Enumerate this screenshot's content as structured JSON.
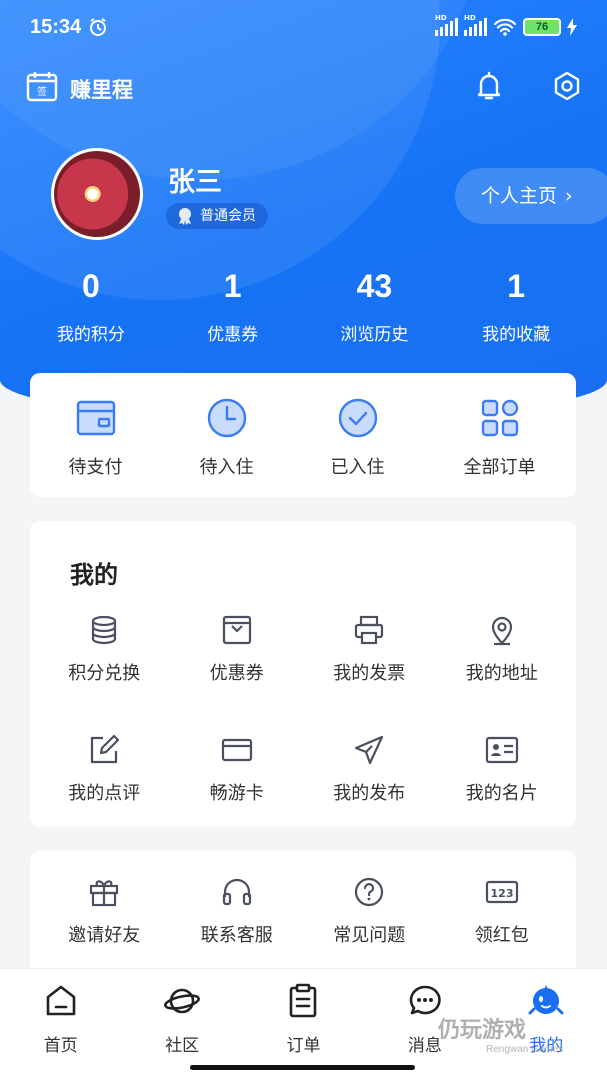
{
  "status_bar": {
    "time": "15:34",
    "battery": "76",
    "signal_label": "HD"
  },
  "header": {
    "brand_name": "赚里程"
  },
  "profile": {
    "name": "张三",
    "member_level": "普通会员",
    "homepage_label": "个人主页",
    "homepage_chevron": "›"
  },
  "stats": [
    {
      "value": "0",
      "label": "我的积分"
    },
    {
      "value": "1",
      "label": "优惠券"
    },
    {
      "value": "43",
      "label": "浏览历史"
    },
    {
      "value": "1",
      "label": "我的收藏"
    }
  ],
  "orders": [
    {
      "label": "待支付",
      "icon": "wallet-icon"
    },
    {
      "label": "待入住",
      "icon": "clock-icon"
    },
    {
      "label": "已入住",
      "icon": "check-circle-icon"
    },
    {
      "label": "全部订单",
      "icon": "grid-icon"
    }
  ],
  "mine": {
    "title": "我的",
    "items": [
      {
        "label": "积分兑换",
        "icon": "coins-icon"
      },
      {
        "label": "优惠券",
        "icon": "coupon-icon"
      },
      {
        "label": "我的发票",
        "icon": "printer-icon"
      },
      {
        "label": "我的地址",
        "icon": "location-icon"
      },
      {
        "label": "我的点评",
        "icon": "edit-icon"
      },
      {
        "label": "畅游卡",
        "icon": "card-icon"
      },
      {
        "label": "我的发布",
        "icon": "send-icon"
      },
      {
        "label": "我的名片",
        "icon": "id-card-icon"
      }
    ]
  },
  "more": {
    "items": [
      {
        "label": "邀请好友",
        "icon": "gift-icon"
      },
      {
        "label": "联系客服",
        "icon": "headset-icon"
      },
      {
        "label": "常见问题",
        "icon": "question-icon"
      },
      {
        "label": "领红包",
        "icon": "number-123-icon"
      }
    ]
  },
  "tabbar": [
    {
      "label": "首页",
      "icon": "home-icon"
    },
    {
      "label": "社区",
      "icon": "planet-icon"
    },
    {
      "label": "订单",
      "icon": "clipboard-icon"
    },
    {
      "label": "消息",
      "icon": "chat-icon"
    },
    {
      "label": "我的",
      "icon": "mascot-icon",
      "active": true
    }
  ],
  "watermark": {
    "text": "仍玩游戏",
    "sub": "Rengwan Games"
  },
  "colors": {
    "primary": "#1a6ef0",
    "icon_blue": "#3b7bf6",
    "icon_gray": "#4a5060"
  }
}
